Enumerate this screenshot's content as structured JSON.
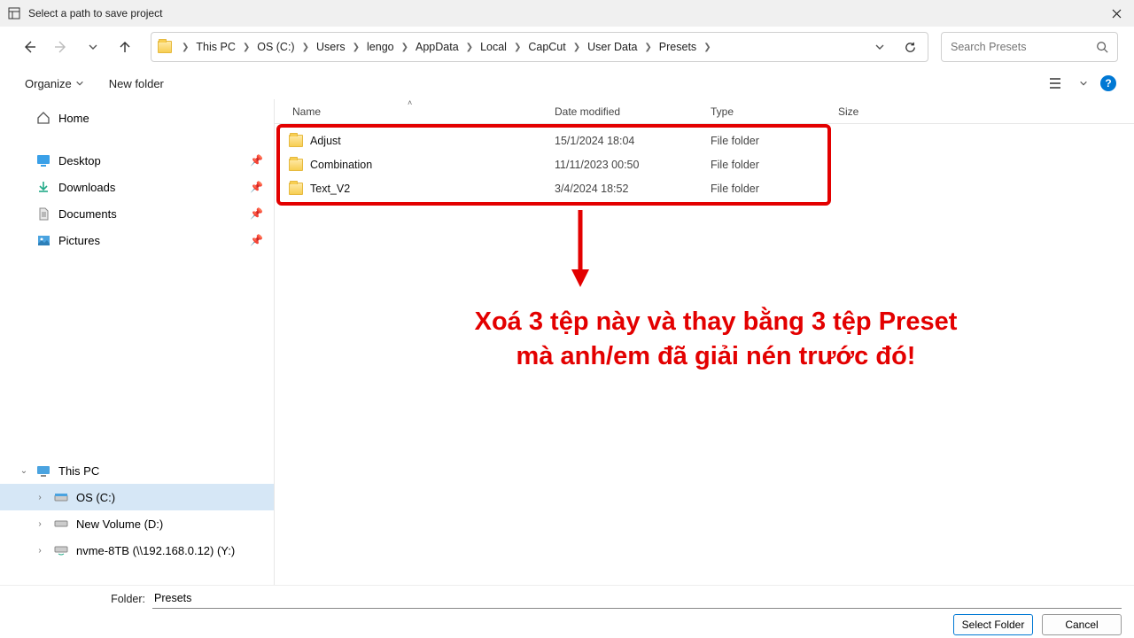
{
  "window": {
    "title": "Select a path to save project"
  },
  "breadcrumbs": [
    "This PC",
    "OS (C:)",
    "Users",
    "lengo",
    "AppData",
    "Local",
    "CapCut",
    "User Data",
    "Presets"
  ],
  "search": {
    "placeholder": "Search Presets"
  },
  "toolbar": {
    "organize": "Organize",
    "new_folder": "New folder"
  },
  "columns": {
    "name": "Name",
    "date": "Date modified",
    "type": "Type",
    "size": "Size"
  },
  "tree": {
    "home": "Home",
    "desktop": "Desktop",
    "downloads": "Downloads",
    "documents": "Documents",
    "pictures": "Pictures",
    "this_pc": "This PC",
    "os_c": "OS (C:)",
    "new_volume": "New Volume (D:)",
    "nvme": "nvme-8TB (\\\\192.168.0.12) (Y:)"
  },
  "rows": [
    {
      "name": "Adjust",
      "date": "15/1/2024 18:04",
      "type": "File folder"
    },
    {
      "name": "Combination",
      "date": "11/11/2023 00:50",
      "type": "File folder"
    },
    {
      "name": "Text_V2",
      "date": "3/4/2024 18:52",
      "type": "File folder"
    }
  ],
  "annotation": {
    "line1": "Xoá 3 tệp này và thay bằng 3 tệp Preset",
    "line2": "mà anh/em đã giải nén trước đó!"
  },
  "footer": {
    "folder_label": "Folder:",
    "folder_value": "Presets",
    "select": "Select Folder",
    "cancel": "Cancel"
  }
}
